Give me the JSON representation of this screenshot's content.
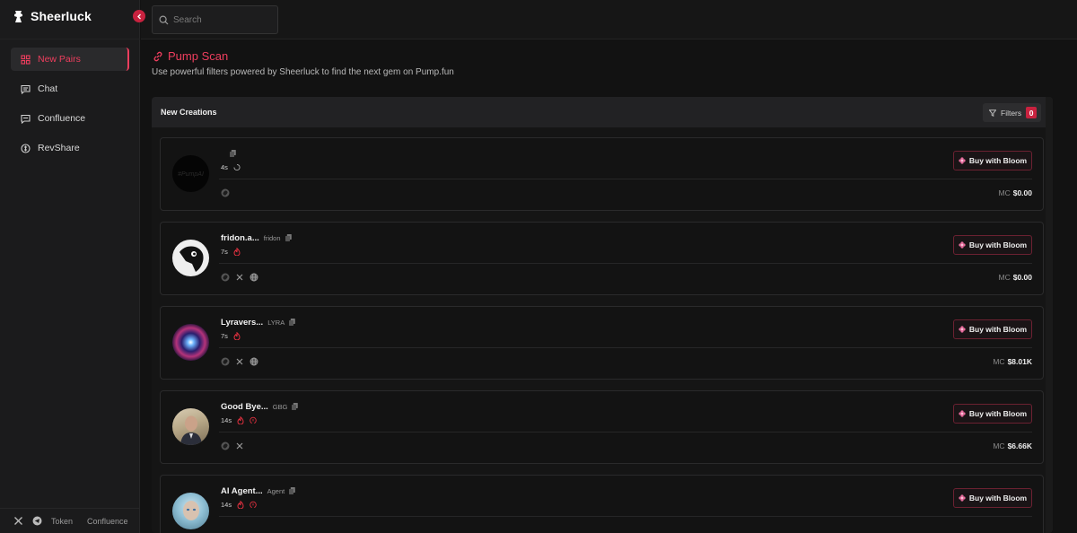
{
  "brand": {
    "name": "Sheerluck"
  },
  "search": {
    "placeholder": "Search"
  },
  "sidebar": {
    "items": [
      {
        "label": "New Pairs",
        "icon": "grid-icon",
        "active": true
      },
      {
        "label": "Chat",
        "icon": "chat-icon",
        "active": false
      },
      {
        "label": "Confluence",
        "icon": "message-square-icon",
        "active": false
      },
      {
        "label": "RevShare",
        "icon": "coin-icon",
        "active": false
      }
    ],
    "footer": {
      "token_label": "Token",
      "confluence_label": "Confluence"
    }
  },
  "page": {
    "title": "Pump Scan",
    "subtitle": "Use powerful filters powered by Sheerluck to find the next gem on Pump.fun"
  },
  "panel": {
    "title": "New Creations",
    "filters_label": "Filters",
    "filters_count": "0"
  },
  "tokens": [
    {
      "name": "",
      "symbol": "",
      "age": "4s",
      "mc_label": "MC",
      "mc_value": "$0.00",
      "buy_label": "Buy with Bloom",
      "avatar_text": "#PumpAI",
      "socials": [
        "pump-icon"
      ]
    },
    {
      "name": "fridon.a...",
      "symbol": "fridon",
      "age": "7s",
      "mc_label": "MC",
      "mc_value": "$0.00",
      "buy_label": "Buy with Bloom",
      "socials": [
        "pump-icon",
        "x-icon",
        "globe-icon"
      ]
    },
    {
      "name": "Lyravers...",
      "symbol": "LYRA",
      "age": "7s",
      "mc_label": "MC",
      "mc_value": "$8.01K",
      "buy_label": "Buy with Bloom",
      "socials": [
        "pump-icon",
        "x-icon",
        "globe-icon"
      ]
    },
    {
      "name": "Good Bye...",
      "symbol": "GBG",
      "age": "14s",
      "mc_label": "MC",
      "mc_value": "$6.66K",
      "buy_label": "Buy with Bloom",
      "socials": [
        "pump-icon",
        "x-icon"
      ]
    },
    {
      "name": "AI Agent...",
      "symbol": "Agent",
      "age": "14s",
      "mc_label": "MC",
      "mc_value": "",
      "buy_label": "Buy with Bloom",
      "socials": []
    }
  ],
  "colors": {
    "accent": "#ef3e5e",
    "accent_dark": "#c8223f",
    "bg": "#121212"
  }
}
